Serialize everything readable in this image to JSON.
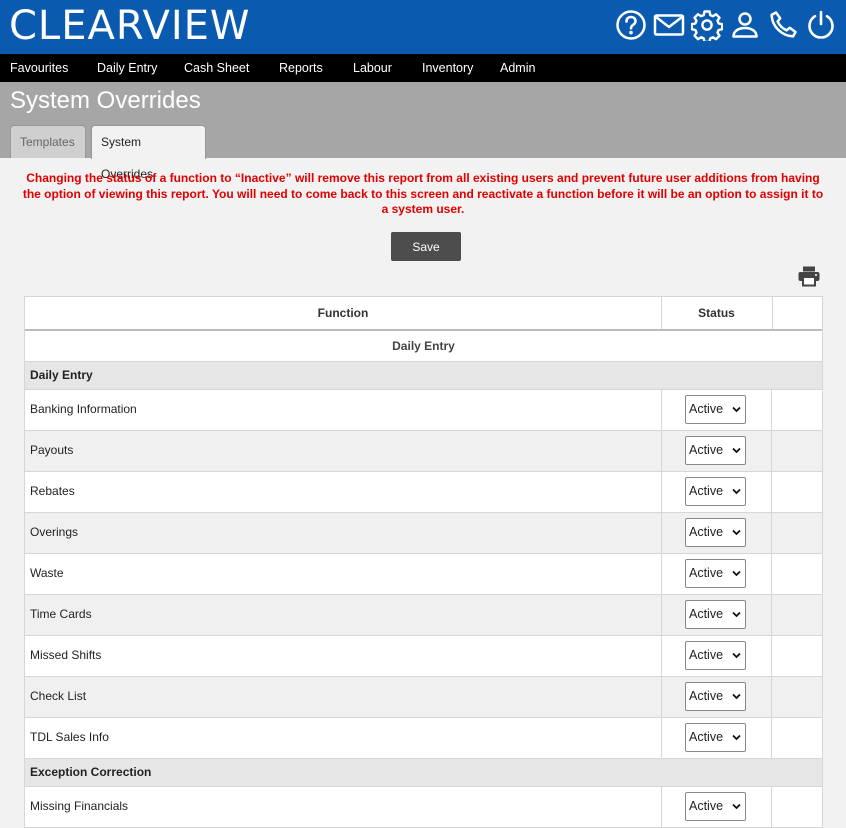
{
  "app": {
    "logo": "CLEARVIEW"
  },
  "header_icons": [
    "help-icon",
    "mail-icon",
    "settings-icon",
    "user-icon",
    "phone-icon",
    "power-icon"
  ],
  "menu": [
    "Favourites",
    "Daily Entry",
    "Cash Sheet",
    "Reports",
    "Labour",
    "Inventory",
    "Admin"
  ],
  "page": {
    "title": "System Overrides"
  },
  "tabs": {
    "templates": "Templates",
    "system_overrides": "System Overrides"
  },
  "warning": "Changing the status of a function to “Inactive” will remove this report from all existing users and prevent future user additions from having the option of viewing this report. You will need to come back to this screen and reactivate a function before it will be an option to assign it to a system user.",
  "save_label": "Save",
  "table": {
    "headers": {
      "function": "Function",
      "status": "Status"
    },
    "section": "Daily Entry",
    "groups": {
      "daily_entry": "Daily Entry",
      "exception_correction": "Exception Correction"
    },
    "rows": [
      {
        "name": "Banking Information",
        "status": "Active"
      },
      {
        "name": "Payouts",
        "status": "Active"
      },
      {
        "name": "Rebates",
        "status": "Active"
      },
      {
        "name": "Overings",
        "status": "Active"
      },
      {
        "name": "Waste",
        "status": "Active"
      },
      {
        "name": "Time Cards",
        "status": "Active"
      },
      {
        "name": "Missed Shifts",
        "status": "Active"
      },
      {
        "name": "Check List",
        "status": "Active"
      },
      {
        "name": "TDL Sales Info",
        "status": "Active"
      }
    ],
    "exception_rows": [
      {
        "name": "Missing Financials",
        "status": "Active"
      }
    ]
  },
  "colors": {
    "header_blue": "#0a5bb0",
    "menu_black": "#000000",
    "warning_red": "#e00000",
    "subheader_gray": "#a6a6a6"
  }
}
